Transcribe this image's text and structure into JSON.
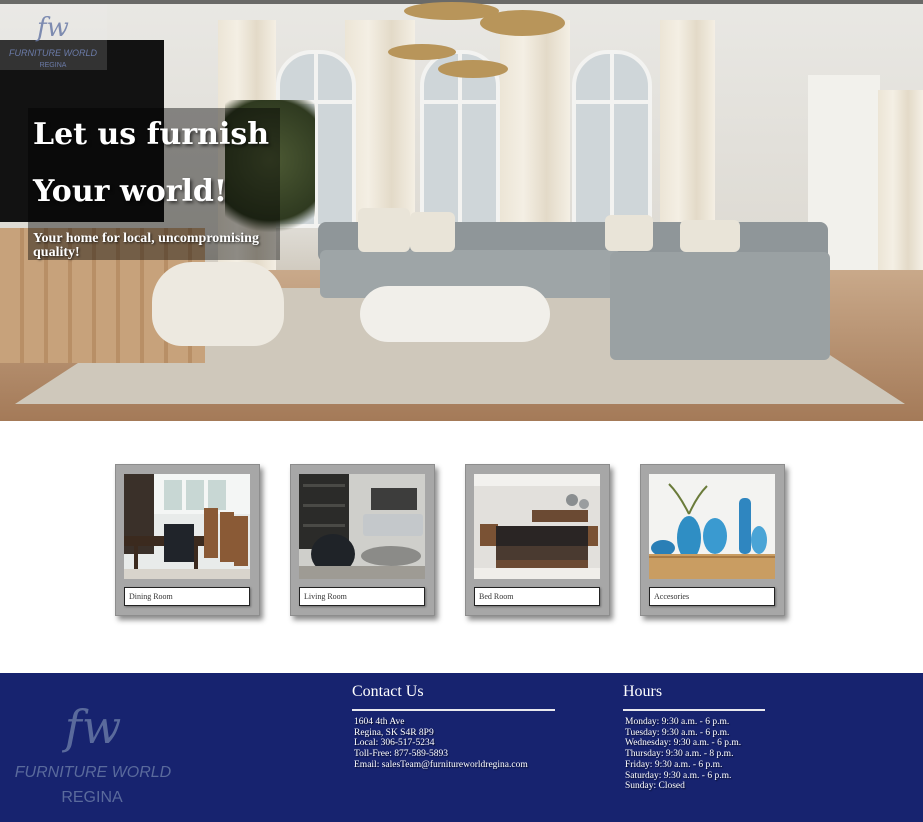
{
  "brand": {
    "monogram": "fw",
    "name": "FURNITURE WORLD",
    "city": "REGINA"
  },
  "hero": {
    "heading_line1": "Let us furnish",
    "heading_line2": "Your world!",
    "subheading": "Your home for local, uncompromising quality!"
  },
  "categories": [
    {
      "label": "Dining Room",
      "image": "dining-room-photo"
    },
    {
      "label": "Living Room",
      "image": "living-room-photo"
    },
    {
      "label": "Bed Room",
      "image": "bedroom-photo"
    },
    {
      "label": "Accesories",
      "image": "accessories-photo"
    }
  ],
  "footer": {
    "contact": {
      "heading": "Contact Us",
      "address_line1": "1604 4th Ave",
      "address_line2": "Regina, SK S4R 8P9",
      "local": "Local: 306-517-5234",
      "toll_free": "Toll-Free: 877-589-5893",
      "email": "Email: salesTeam@furnitureworldregina.com"
    },
    "hours": {
      "heading": "Hours",
      "lines": [
        "Monday: 9:30 a.m. - 6 p.m.",
        "Tuesday: 9:30 a.m. - 6 p.m.",
        "Wednesday: 9:30 a.m. - 6 p.m.",
        "Thursday: 9:30 a.m. - 8 p.m.",
        "Friday: 9:30 a.m. - 6 p.m.",
        "Saturday: 9:30 a.m. - 6 p.m.",
        "Sunday: Closed"
      ]
    }
  },
  "colors": {
    "footer_background": "#17236f",
    "card_frame": "#a7a7a7",
    "logo_blue": "#5a6a9c"
  }
}
